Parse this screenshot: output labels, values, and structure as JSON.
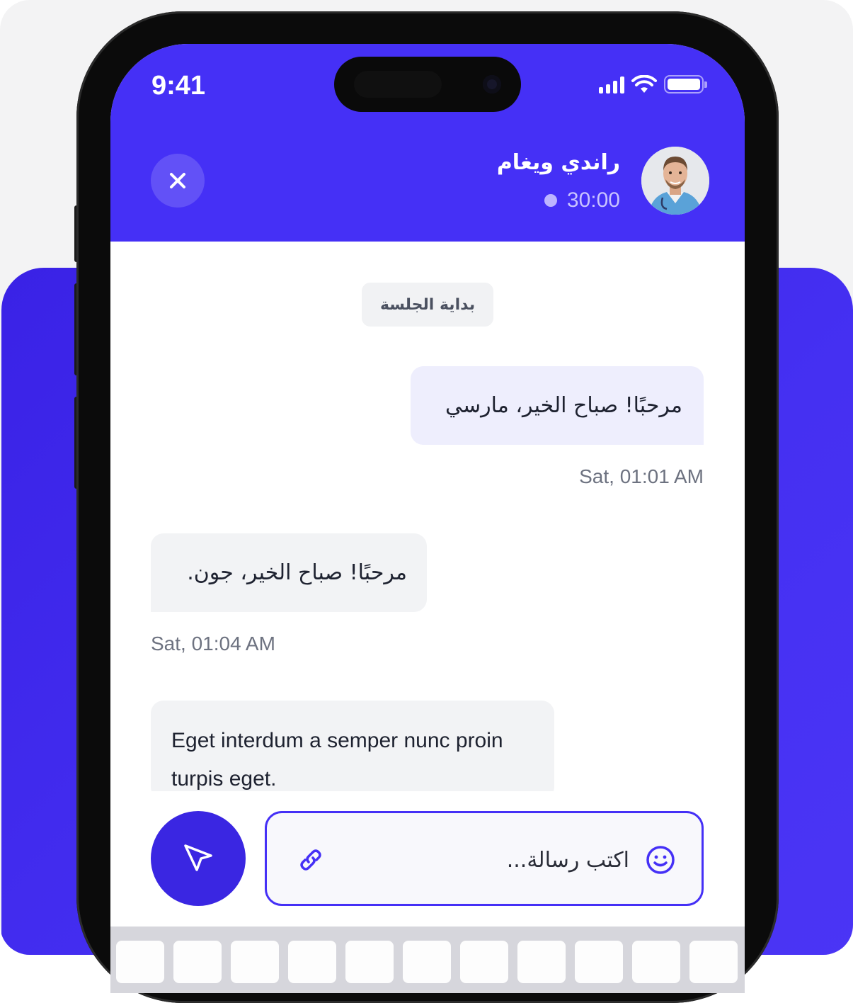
{
  "status_bar": {
    "time": "9:41"
  },
  "header": {
    "contact_name": "راندي ويغام",
    "timer": "30:00"
  },
  "chat": {
    "session_label": "بداية الجلسة",
    "messages": [
      {
        "direction": "outgoing",
        "text": "مرحبًا! صباح الخير، مارسي",
        "time": "Sat, 01:01 AM"
      },
      {
        "direction": "incoming",
        "text": "مرحبًا! صباح الخير، جون.",
        "time": "Sat, 01:04 AM"
      },
      {
        "direction": "incoming",
        "text": "Eget interdum a semper nunc proin turpis eget."
      }
    ]
  },
  "composer": {
    "placeholder": "اكتب رسالة..."
  },
  "icons": {
    "close": "close-icon",
    "send": "send-icon",
    "attach": "link-icon",
    "emoji": "emoji-icon"
  },
  "colors": {
    "brand": "#4530f6",
    "outgoing_bubble": "#eeeefd",
    "incoming_bubble": "#f2f3f5",
    "send_button": "#3a26e2"
  }
}
